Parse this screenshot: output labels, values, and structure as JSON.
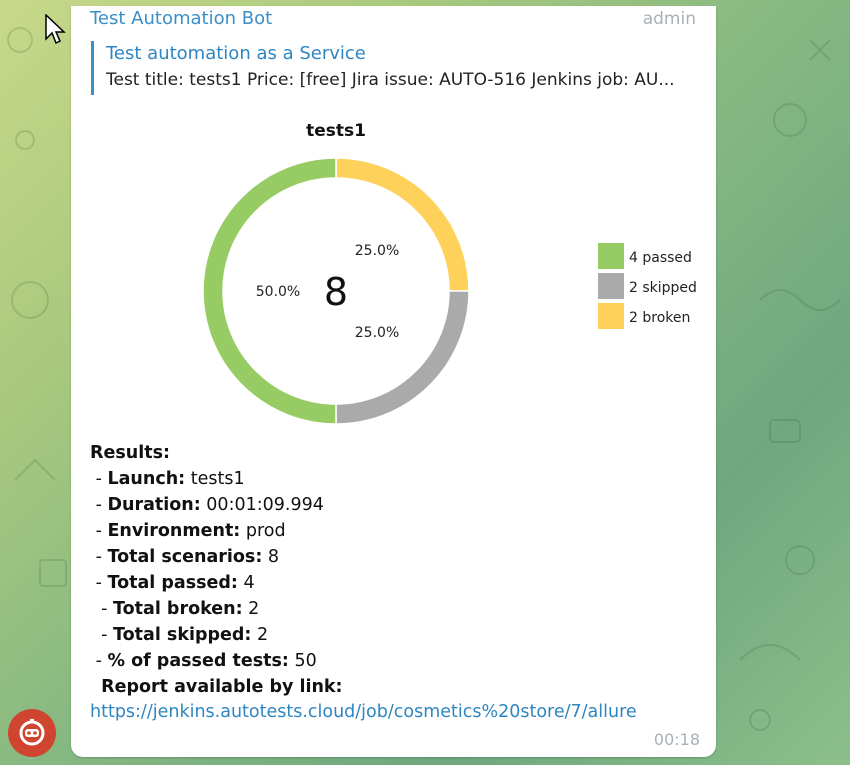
{
  "message": {
    "sender": "Test Automation Bot",
    "role": "admin",
    "reply": {
      "title": "Test automation as a Service",
      "text": "Test title: tests1 Price: [free] Jira issue: AUTO-516 Jenkins job: AU..."
    },
    "results_heading": "Results:",
    "results": [
      {
        "prefix": " - ",
        "label": "Launch:",
        "value": " tests1"
      },
      {
        "prefix": " - ",
        "label": "Duration:",
        "value": " 00:01:09.994"
      },
      {
        "prefix": " - ",
        "label": "Environment:",
        "value": " prod"
      },
      {
        "prefix": " - ",
        "label": "Total scenarios:",
        "value": " 8"
      },
      {
        "prefix": " - ",
        "label": "Total passed:",
        "value": " 4"
      },
      {
        "prefix": "  - ",
        "label": "Total broken:",
        "value": " 2"
      },
      {
        "prefix": "  - ",
        "label": "Total skipped:",
        "value": " 2"
      },
      {
        "prefix": " - ",
        "label": "% of passed tests:",
        "value": " 50"
      }
    ],
    "report_label": "Report available by link:",
    "report_link": "https://jenkins.autotests.cloud/job/cosmetics%20store/7/allure",
    "time": "00:18"
  },
  "chart_data": {
    "type": "pie",
    "title": "tests1",
    "center_label": "8",
    "slices": [
      {
        "label": "4 passed",
        "value": 4,
        "percent_label": "50.0%",
        "color": "#97cc64"
      },
      {
        "label": "2 skipped",
        "value": 2,
        "percent_label": "25.0%",
        "color": "#aaaaaa"
      },
      {
        "label": "2 broken",
        "value": 2,
        "percent_label": "25.0%",
        "color": "#fed25a"
      }
    ],
    "legend_position": "right"
  },
  "icons": {
    "cursor": "mouse-pointer-icon",
    "avatar": "bot-avatar-icon"
  }
}
